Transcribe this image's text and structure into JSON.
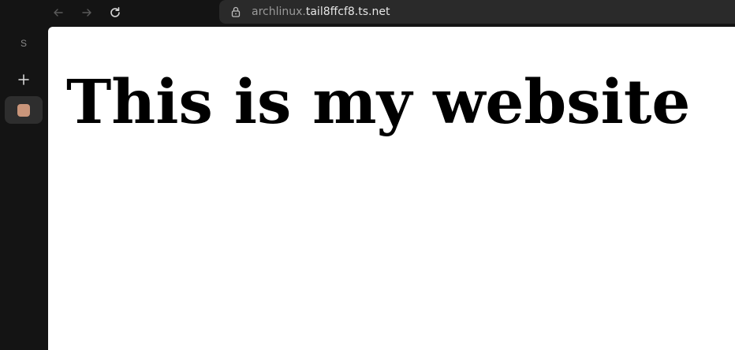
{
  "browser": {
    "back_icon": "arrow-left-icon",
    "forward_icon": "arrow-right-icon",
    "reload_icon": "reload-icon",
    "lock_icon": "lock-icon",
    "url_subdomain": "archlinux.",
    "url_domain": "tail8ffcf8.ts.net"
  },
  "sidebar": {
    "space_label": "S",
    "new_tab_icon": "plus-icon",
    "tabs": [
      {
        "favicon_color": "#c9957a"
      }
    ]
  },
  "page": {
    "heading": "This is my website"
  }
}
